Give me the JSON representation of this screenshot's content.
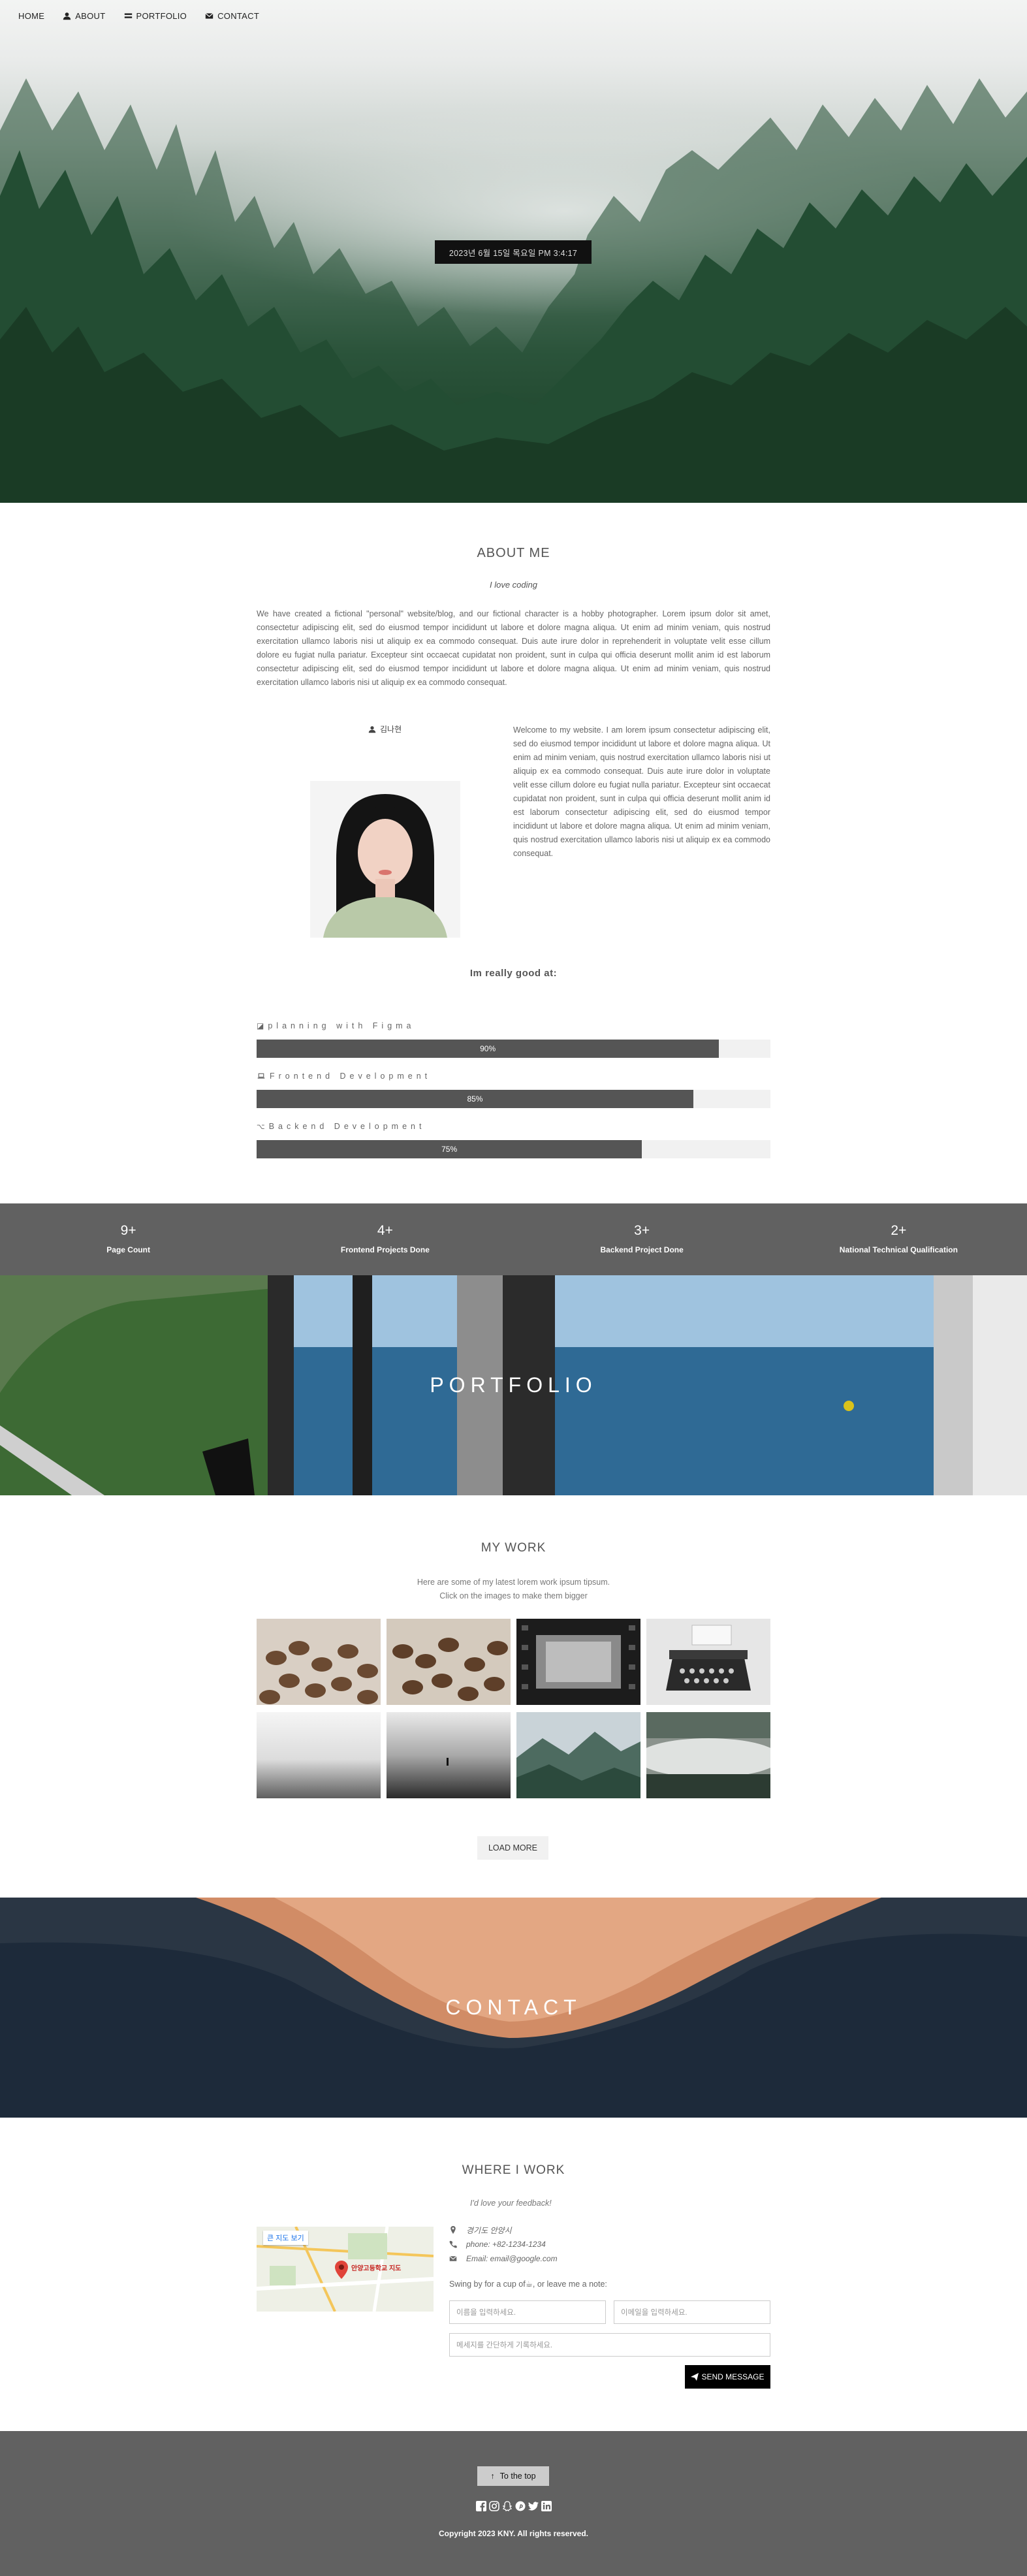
{
  "nav": {
    "items": [
      {
        "label": "HOME",
        "icon": ""
      },
      {
        "label": "ABOUT",
        "icon": "user-icon"
      },
      {
        "label": "PORTFOLIO",
        "icon": "grid-icon"
      },
      {
        "label": "CONTACT",
        "icon": "envelope-icon"
      }
    ]
  },
  "hero": {
    "datetime": "2023년 6월 15일 목요일 PM 3:4:17"
  },
  "about": {
    "title": "ABOUT ME",
    "subtitle": "I love coding",
    "intro": "We have created a fictional \"personal\" website/blog, and our fictional character is a hobby photographer. Lorem ipsum dolor sit amet, consectetur adipiscing elit, sed do eiusmod tempor incididunt ut labore et dolore magna aliqua. Ut enim ad minim veniam, quis nostrud exercitation ullamco laboris nisi ut aliquip ex ea commodo consequat. Duis aute irure dolor in reprehenderit in voluptate velit esse cillum dolore eu fugiat nulla pariatur. Excepteur sint occaecat cupidatat non proident, sunt in culpa qui officia deserunt mollit anim id est laborum consectetur adipiscing elit, sed do eiusmod tempor incididunt ut labore et dolore magna aliqua. Ut enim ad minim veniam, quis nostrud exercitation ullamco laboris nisi ut aliquip ex ea commodo consequat.",
    "name": "김나현",
    "welcome": "Welcome to my website. I am lorem ipsum consectetur adipiscing elit, sed do eiusmod tempor incididunt ut labore et dolore magna aliqua. Ut enim ad minim veniam, quis nostrud exercitation ullamco laboris nisi ut aliquip ex ea commodo consequat. Duis aute irure dolor in voluptate velit esse cillum dolore eu fugiat nulla pariatur. Excepteur sint occaecat cupidatat non proident, sunt in culpa qui officia deserunt mollit anim id est laborum consectetur adipiscing elit, sed do eiusmod tempor incididunt ut labore et dolore magna aliqua. Ut enim ad minim veniam, quis nostrud exercitation ullamco laboris nisi ut aliquip ex ea commodo consequat.",
    "skills_title": "Im really good at:",
    "skills": [
      {
        "label": "planning with Figma",
        "icon": "figma-icon",
        "percent": 90,
        "text": "90%"
      },
      {
        "label": "Frontend Development",
        "icon": "laptop-icon",
        "percent": 85,
        "text": "85%"
      },
      {
        "label": "Backend Development",
        "icon": "code-icon",
        "percent": 75,
        "text": "75%"
      }
    ]
  },
  "stats": [
    {
      "num": "9+",
      "label": "Page Count"
    },
    {
      "num": "4+",
      "label": "Frontend Projects Done"
    },
    {
      "num": "3+",
      "label": "Backend Project Done"
    },
    {
      "num": "2+",
      "label": "National Technical Qualification"
    }
  ],
  "portfolio": {
    "banner": "PORTFOLIO",
    "title": "MY WORK",
    "desc1": "Here are some of my latest lorem work ipsum tipsum.",
    "desc2": "Click on the images to make them bigger",
    "load_more": "LOAD MORE"
  },
  "contact": {
    "banner": "CONTACT",
    "title": "WHERE I WORK",
    "subtitle": "I'd love your feedback!",
    "map_link": "큰 지도 보기",
    "map_place": "안양고등학교 지도",
    "location": "경기도 안양시",
    "phone": "phone: +82-1234-1234",
    "email": "Email: email@google.com",
    "note": "Swing by for a cup of☕, or leave me a note:",
    "name_placeholder": "이름을 입력하세요.",
    "email_placeholder": "이메일을 입력하세요.",
    "message_placeholder": "메세지를 간단하게 기록하세요.",
    "send": "SEND MESSAGE"
  },
  "footer": {
    "to_top": "To the top",
    "copyright": "Copyright 2023 KNY. All rights reserved."
  },
  "colors": {
    "stats_bg": "#616161",
    "bar_fill": "#555555",
    "footer_bg": "#616161"
  }
}
